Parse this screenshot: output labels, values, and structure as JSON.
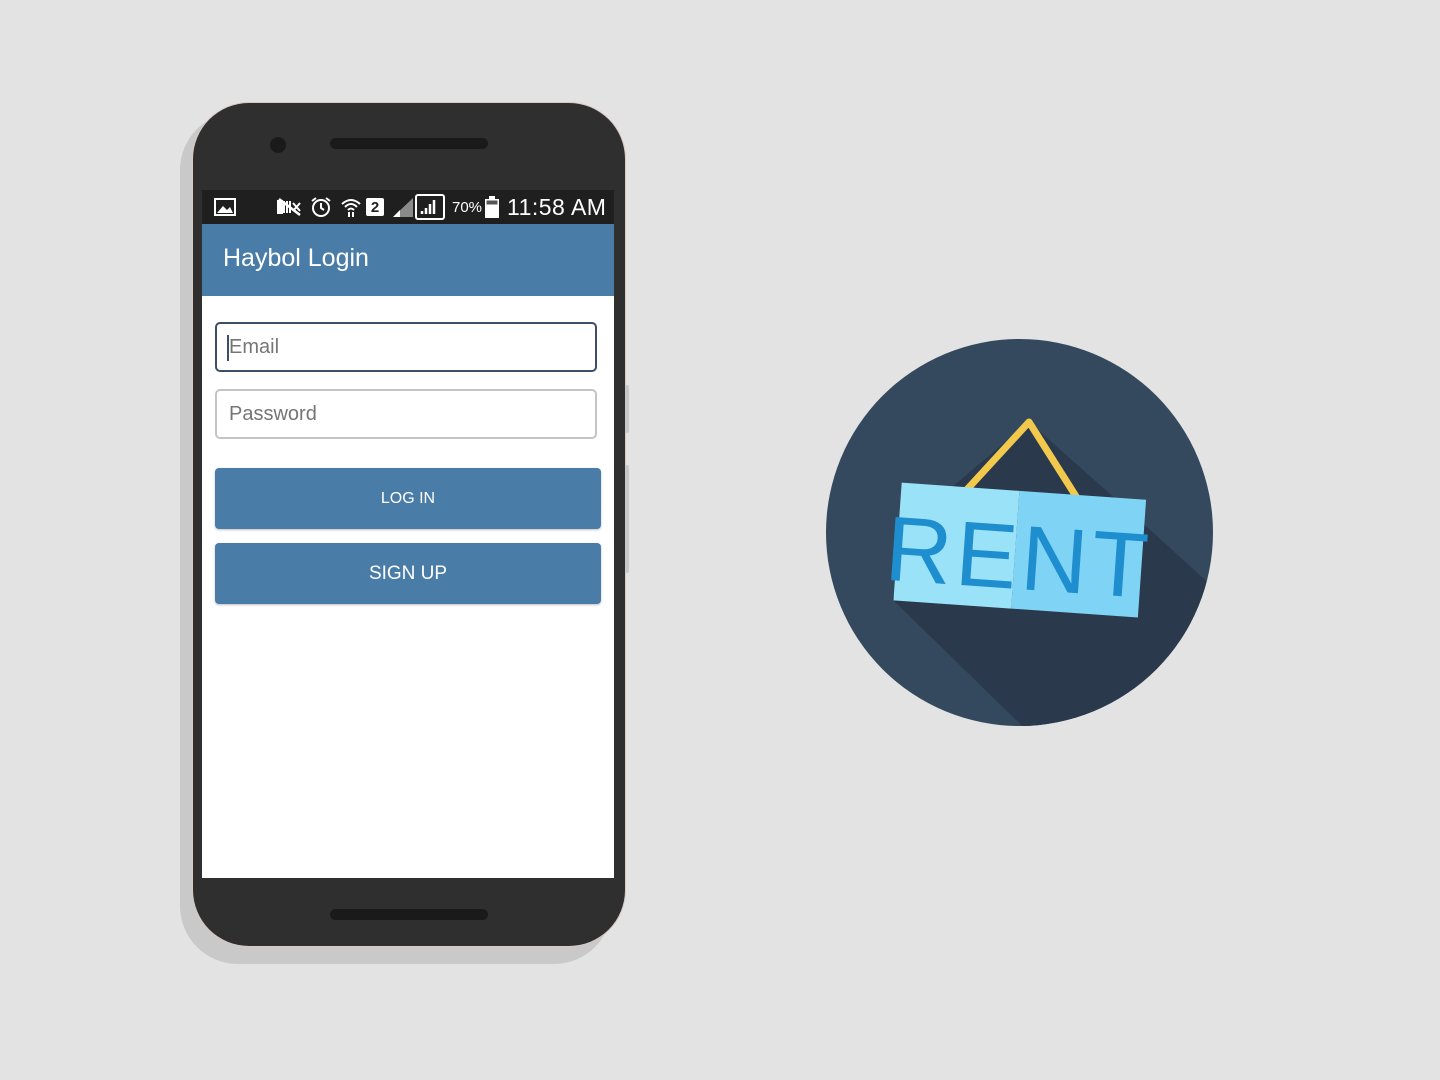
{
  "status_bar": {
    "sim_number": "2",
    "battery": "70%",
    "time": "11:58 AM",
    "icons": [
      "image-icon",
      "mute-icon",
      "alarm-icon",
      "wifi-icon",
      "sim-badge-icon",
      "signal-icon",
      "signal-boxed-icon",
      "battery-icon"
    ]
  },
  "app_bar": {
    "title": "Haybol Login"
  },
  "form": {
    "email_placeholder": "Email",
    "password_placeholder": "Password",
    "login_label": "LOG IN",
    "signup_label": "SIGN UP"
  },
  "logo": {
    "text": "RENT",
    "colors": {
      "circle": "#34495e",
      "shadow": "#2a3a4c",
      "sign_left": "#9ae2f7",
      "sign_right": "#7fd3f5",
      "letters": "#1e8ecf",
      "string": "#f2c94c"
    }
  },
  "colors": {
    "background": "#e3e3e3",
    "accent": "#4a7ca8",
    "phone_body": "#2f2f2f"
  }
}
